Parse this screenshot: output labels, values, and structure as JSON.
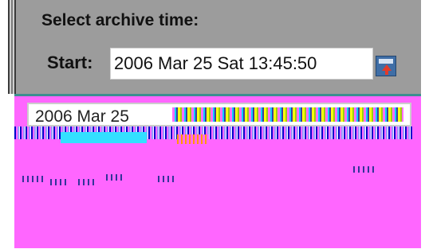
{
  "archive": {
    "title": "Select archive time:",
    "start_label": "Start:",
    "start_value": "2006 Mar 25 Sat 13:45:50"
  },
  "popup": {
    "field_value": "2006 Mar 25"
  },
  "colors": {
    "panel_bg": "#9c9c9c",
    "popup_bg": "#ff66ff",
    "popup_border": "#3d8f8f",
    "calendar_button": "#3f6ea6"
  },
  "icons": {
    "calendar": "calendar-picker-icon"
  }
}
